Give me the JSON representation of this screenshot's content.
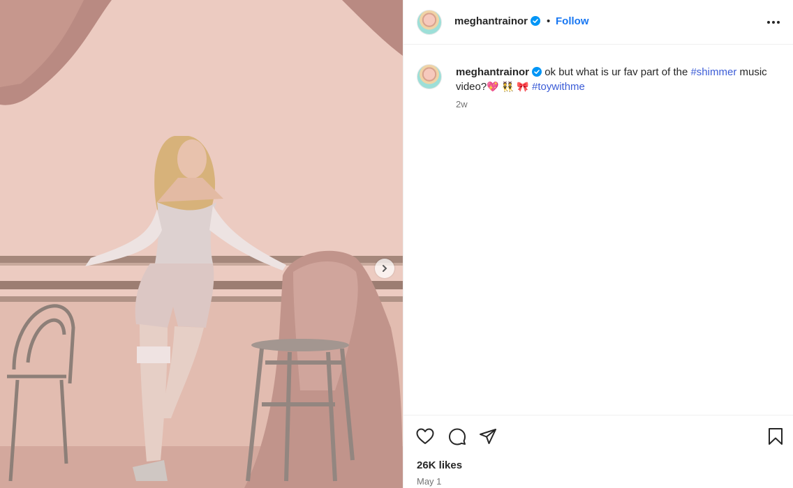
{
  "post": {
    "username": "meghantrainor",
    "separator": "•",
    "follow_label": "Follow",
    "more_icon": "more-options-icon",
    "verified_color": "#0095f6",
    "caption": {
      "username": "meghantrainor",
      "text_part1": "ok but what is ur fav part of the",
      "hashtag1": "#shimmer",
      "text_part2": "music video?",
      "emojis": [
        "💖",
        "👯",
        "🎀"
      ],
      "hashtag2": "#toywithme"
    },
    "relative_time": "2w",
    "likes": "26K likes",
    "date": "May 1"
  },
  "icons": {
    "like": "heart-icon",
    "comment": "comment-icon",
    "share": "share-icon",
    "save": "bookmark-icon",
    "next": "chevron-right-icon"
  },
  "colors": {
    "link": "#1877f2",
    "hashtag": "#3b5cd6",
    "secondary_text": "#737373"
  }
}
